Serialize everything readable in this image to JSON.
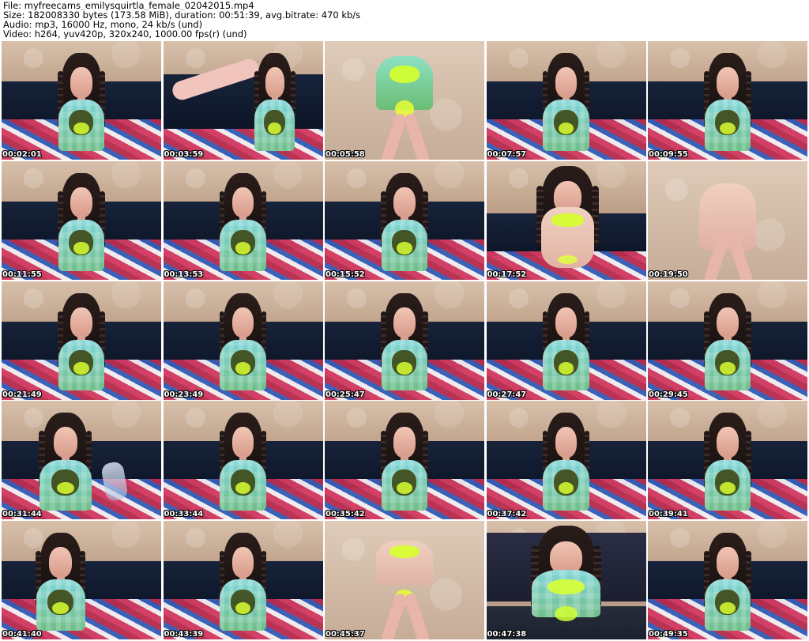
{
  "header": {
    "file_line": "File: myfreecams_emilysquirtla_female_02042015.mp4",
    "size_line": "Size: 182008330 bytes (173.58 MiB), duration: 00:51:39, avg.bitrate: 470 kb/s",
    "audio_line": "Audio: mp3, 16000 Hz, mono, 24 kb/s (und)",
    "video_line": "Video: h264, yuv420p, 320x240, 1000.00 fps(r) (und)"
  },
  "thumbnails": [
    "00:02:01",
    "00:03:59",
    "00:05:58",
    "00:07:57",
    "00:09:55",
    "00:11:55",
    "00:13:53",
    "00:15:52",
    "00:17:52",
    "00:19:50",
    "00:21:49",
    "00:23:49",
    "00:25:47",
    "00:27:47",
    "00:29:45",
    "00:31:44",
    "00:33:44",
    "00:35:42",
    "00:37:42",
    "00:39:41",
    "00:41:40",
    "00:43:39",
    "00:45:37",
    "00:47:38",
    "00:49:35"
  ]
}
